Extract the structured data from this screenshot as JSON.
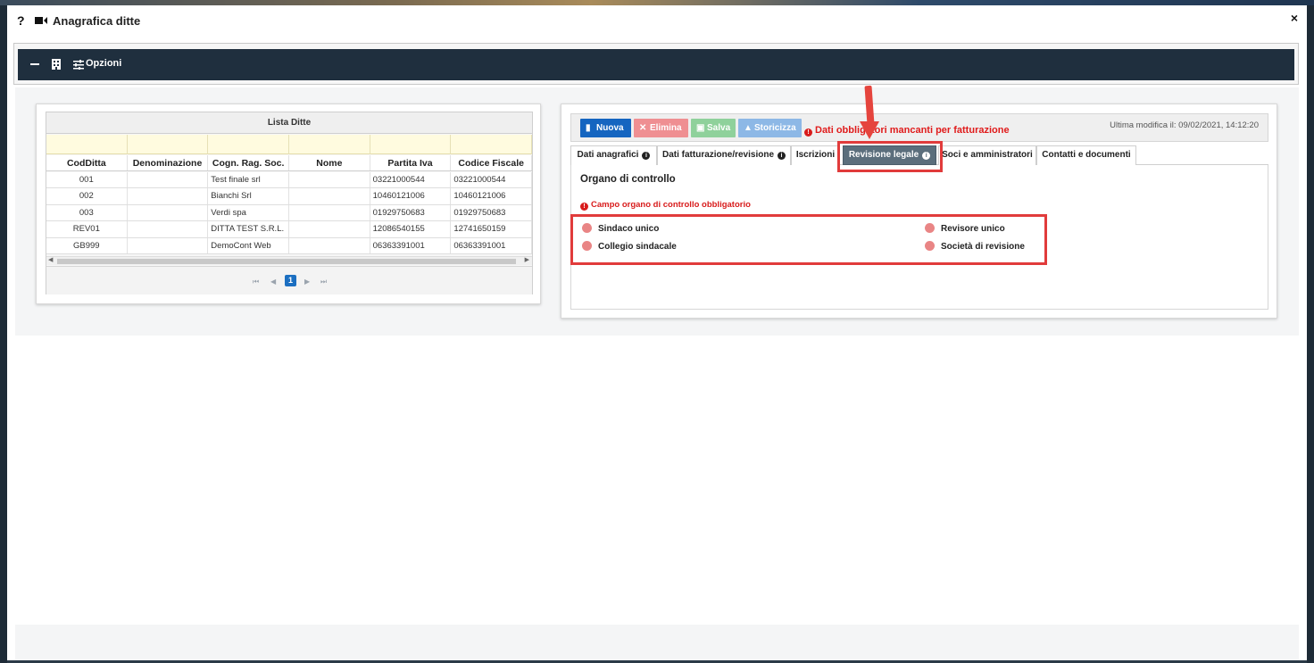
{
  "modal": {
    "help_glyph": "?",
    "title": "Anagrafica ditte",
    "close_glyph": "×"
  },
  "options_bar": {
    "label": "Opzioni",
    "icons": [
      "minus-icon",
      "building-icon",
      "sliders-icon"
    ]
  },
  "grid": {
    "title": "Lista Ditte",
    "columns": [
      "CodDitta",
      "Denominazione",
      "Cogn. Rag. Soc.",
      "Nome",
      "Partita Iva",
      "Codice Fiscale"
    ],
    "rows": [
      [
        "001",
        "",
        "Test finale srl",
        "",
        "03221000544",
        "03221000544"
      ],
      [
        "002",
        "",
        "Bianchi Srl",
        "",
        "10460121006",
        "10460121006"
      ],
      [
        "003",
        "",
        "Verdi spa",
        "",
        "01929750683",
        "01929750683"
      ],
      [
        "REV01",
        "",
        "DITTA TEST S.R.L.",
        "",
        "12086540155",
        "12741650159"
      ],
      [
        "GB999",
        "",
        "DemoCont Web",
        "",
        "06363391001",
        "06363391001"
      ]
    ],
    "pager": {
      "first": "⏮",
      "prev": "◀",
      "current_page": "1",
      "next": "▶",
      "last": "⏭"
    }
  },
  "toolbar": {
    "nuova": "Nuova",
    "elimina": "Elimina",
    "salva": "Salva",
    "storicizza": "Storicizza",
    "warning": "Dati obbligatori mancanti per fatturazione",
    "last_modified": "Ultima modifica il: 09/02/2021, 14:12:20"
  },
  "tabs": [
    {
      "label": "Dati anagrafici",
      "info": true,
      "active": false
    },
    {
      "label": "Dati fatturazione/revisione",
      "info": true,
      "active": false
    },
    {
      "label": "Iscrizioni",
      "info": false,
      "active": false
    },
    {
      "label": "Revisione legale",
      "info": true,
      "active": true
    },
    {
      "label": "Soci e amministratori",
      "info": false,
      "active": false
    },
    {
      "label": "Contatti e documenti",
      "info": false,
      "active": false
    }
  ],
  "revisione_legale": {
    "section_title": "Organo di controllo",
    "error_message": "Campo organo di controllo obbligatorio",
    "options": [
      "Sindaco unico",
      "Collegio sindacale",
      "Revisore unico",
      "Società di revisione"
    ]
  },
  "colors": {
    "primary": "#1565c0",
    "danger": "#ef8f92",
    "success": "#8fd19b",
    "info": "#8db8e6",
    "error_text": "#e01b1b",
    "active_tab": "#5b6e7c",
    "annotation": "#e13b3b",
    "dark_bar": "#1f2f3e"
  }
}
